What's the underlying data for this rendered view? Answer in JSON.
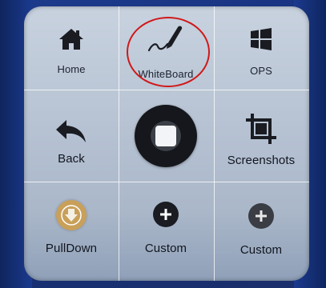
{
  "panel": {
    "items": [
      {
        "label": "Home",
        "icon": "home-icon"
      },
      {
        "label": "WhiteBoard",
        "icon": "pen-icon"
      },
      {
        "label": "OPS",
        "icon": "windows-icon"
      },
      {
        "label": "Back",
        "icon": "back-arrow-icon"
      },
      {
        "label": "",
        "icon": "home-button-icon"
      },
      {
        "label": "Screenshots",
        "icon": "crop-icon"
      },
      {
        "label": "PullDown",
        "icon": "pulldown-icon"
      },
      {
        "label": "Custom",
        "icon": "plus-icon"
      },
      {
        "label": "Custom",
        "icon": "plus-icon"
      }
    ]
  },
  "colors": {
    "highlight": "#d01818",
    "icon": "#1a1c22",
    "pulldown": "#c9a05a"
  }
}
